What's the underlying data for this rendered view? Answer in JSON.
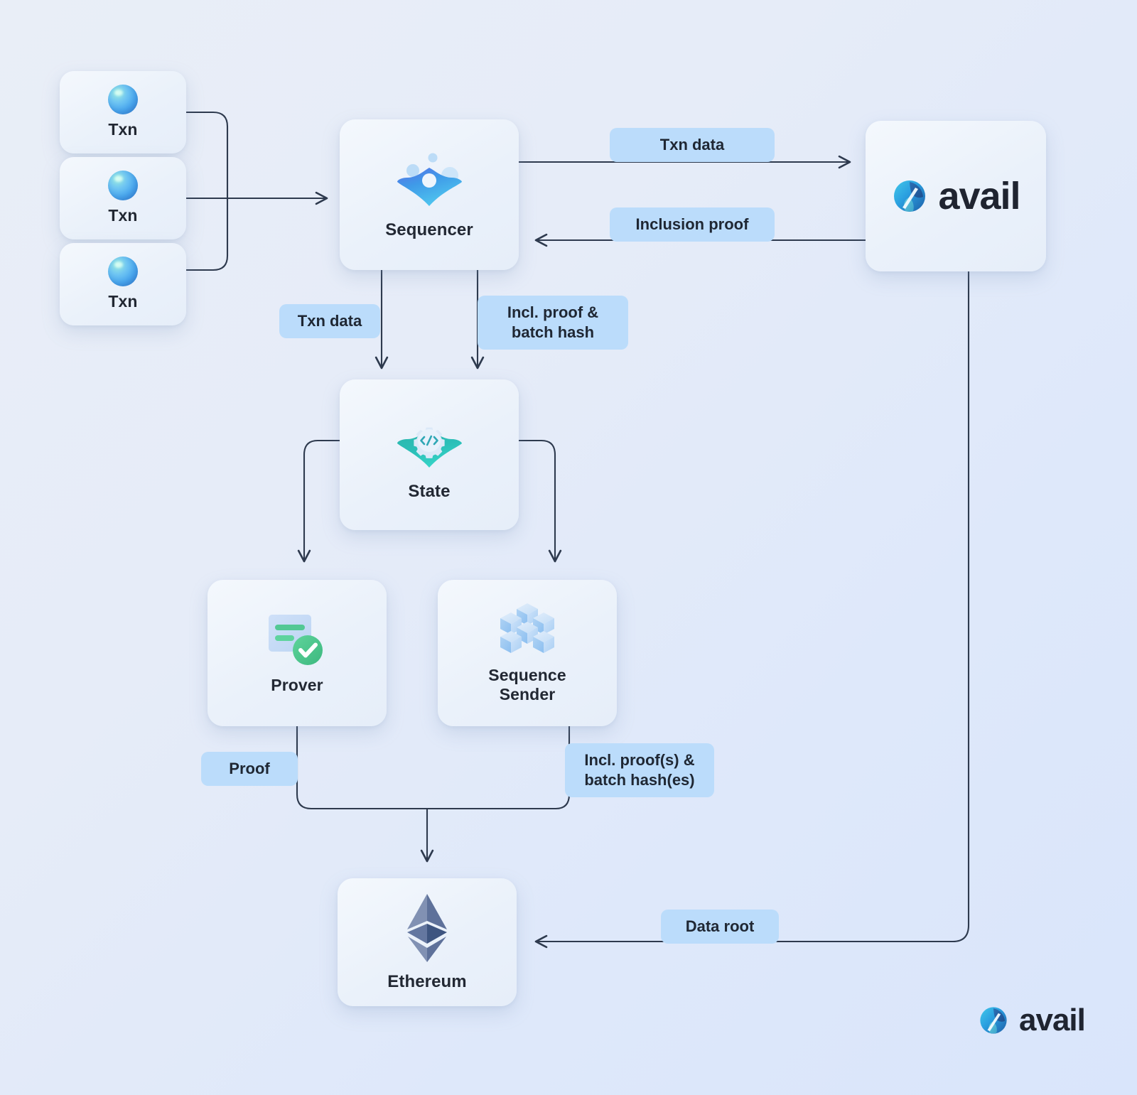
{
  "diagram": {
    "title": "Avail rollup data availability flow",
    "background_from": "#e9eef7",
    "background_to": "#d9e5fb",
    "line_color": "#2e3a4e",
    "pill_color": "#bbdcfb",
    "text_color": "#222833"
  },
  "nodes": {
    "txn1": {
      "label": "Txn",
      "icon": "sphere-icon"
    },
    "txn2": {
      "label": "Txn",
      "icon": "sphere-icon"
    },
    "txn3": {
      "label": "Txn",
      "icon": "sphere-icon"
    },
    "sequencer": {
      "label": "Sequencer",
      "icon": "sequencer-rhombus-icon"
    },
    "avail": {
      "label": "avail",
      "icon": "avail-logo-icon"
    },
    "state": {
      "label": "State",
      "icon": "gear-code-rhombus-icon"
    },
    "prover": {
      "label": "Prover",
      "icon": "document-check-icon"
    },
    "sequence_sender": {
      "label": "Sequence\nSender",
      "label_line1": "Sequence",
      "label_line2": "Sender",
      "icon": "cube-blocks-icon"
    },
    "ethereum": {
      "label": "Ethereum",
      "icon": "ethereum-diamond-icon"
    }
  },
  "edge_labels": {
    "txn_data_to_avail": "Txn data",
    "inclusion_proof_from_avail": "Inclusion proof",
    "txn_data_to_state": "Txn data",
    "incl_proof_batch_hash": "Incl. proof &\nbatch hash",
    "proof": "Proof",
    "incl_proofs_batch_hashes": "Incl. proof(s) &\nbatch hash(es)",
    "data_root": "Data root"
  },
  "watermark": {
    "label": "avail",
    "icon": "avail-logo-icon"
  }
}
